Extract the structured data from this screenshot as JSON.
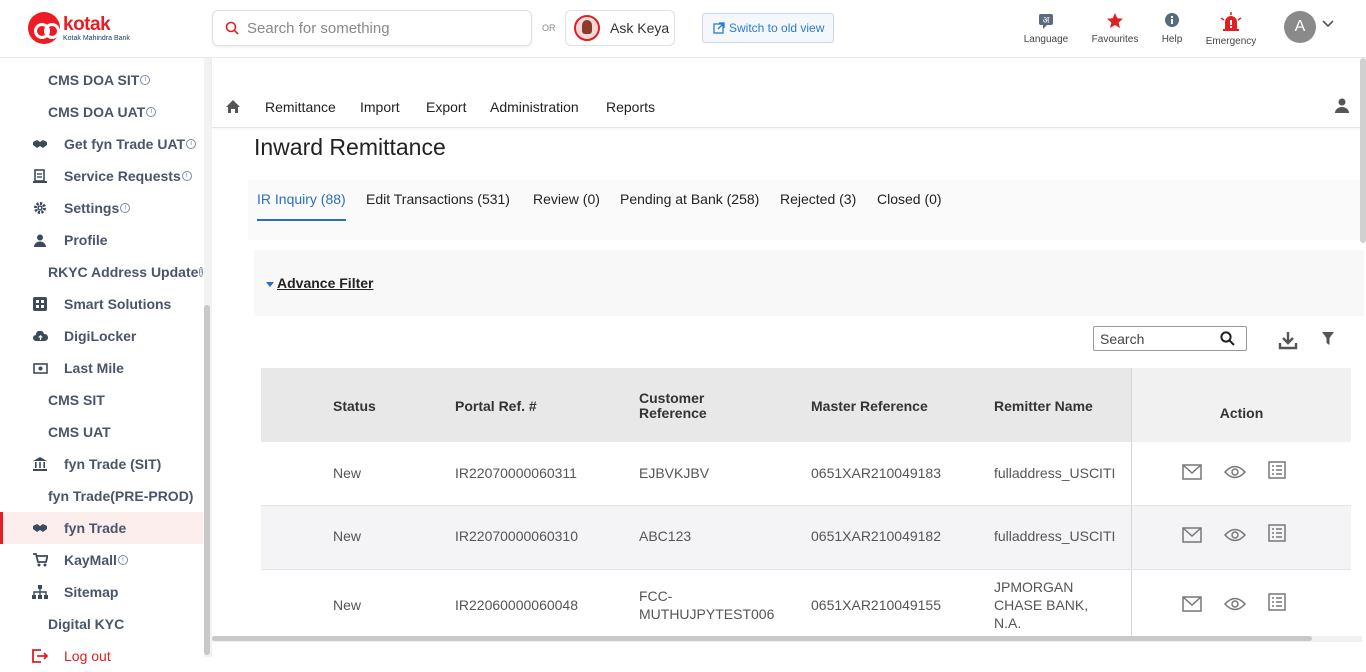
{
  "header": {
    "brand": "kotak",
    "brand_sub": "Kotak Mahindra Bank",
    "search_placeholder": "Search for something",
    "or_label": "OR",
    "ask_keya": "Ask Keya",
    "switch_old_view": "Switch to old view",
    "language": "Language",
    "favourites": "Favourites",
    "help": "Help",
    "emergency": "Emergency",
    "user_initial": "A",
    "language_glyph": "अ"
  },
  "sidebar": {
    "items": [
      {
        "label": "CMS DOA SIT",
        "icon": "none",
        "info": true
      },
      {
        "label": "CMS DOA UAT",
        "icon": "none",
        "info": true
      },
      {
        "label": "Get fyn Trade UAT",
        "icon": "handshake-icon",
        "info": true
      },
      {
        "label": "Service Requests",
        "icon": "service-request-icon",
        "info": true
      },
      {
        "label": "Settings",
        "icon": "gear-icon",
        "info": true
      },
      {
        "label": "Profile",
        "icon": "person-icon",
        "info": false
      },
      {
        "label": "RKYC Address Update",
        "icon": "none",
        "info": true
      },
      {
        "label": "Smart Solutions",
        "icon": "smart-solutions-icon",
        "info": false
      },
      {
        "label": "DigiLocker",
        "icon": "cloud-icon",
        "info": false
      },
      {
        "label": "Last Mile",
        "icon": "cash-icon",
        "info": false
      },
      {
        "label": "CMS SIT",
        "icon": "none",
        "info": false
      },
      {
        "label": "CMS UAT",
        "icon": "none",
        "info": false
      },
      {
        "label": "fyn Trade (SIT)",
        "icon": "bank-icon",
        "info": false
      },
      {
        "label": "fyn Trade(PRE-PROD)",
        "icon": "none",
        "info": false
      },
      {
        "label": "fyn Trade",
        "icon": "handshake-icon",
        "info": false,
        "active": true
      },
      {
        "label": "KayMall",
        "icon": "cart-icon",
        "info": true
      },
      {
        "label": "Sitemap",
        "icon": "sitemap-icon",
        "info": false
      },
      {
        "label": "Digital KYC",
        "icon": "none",
        "info": false
      },
      {
        "label": "Log out",
        "icon": "logout-icon",
        "info": false
      }
    ],
    "info_glyph": "i"
  },
  "nav": {
    "items": [
      "Remittance",
      "Import",
      "Export",
      "Administration",
      "Reports"
    ]
  },
  "page": {
    "title": "Inward Remittance",
    "tabs": [
      "IR Inquiry (88)",
      "Edit Transactions (531)",
      "Review (0)",
      "Pending at Bank (258)",
      "Rejected (3)",
      "Closed (0)"
    ],
    "active_tab": 0,
    "advance_filter": "Advance Filter",
    "table_search_placeholder": "Search"
  },
  "table": {
    "columns": [
      "Status",
      "Portal Ref. #",
      "Customer\nReference",
      "Master Reference",
      "Remitter Name",
      "Action"
    ],
    "rows": [
      {
        "status": "New",
        "portal_ref": "IR22070000060311",
        "customer_ref": "EJBVKJBV",
        "master_ref": "0651XAR210049183",
        "remitter": "fulladdress_USCITI"
      },
      {
        "status": "New",
        "portal_ref": "IR22070000060310",
        "customer_ref": "ABC123",
        "master_ref": "0651XAR210049182",
        "remitter": "fulladdress_USCITI"
      },
      {
        "status": "New",
        "portal_ref": "IR22060000060048",
        "customer_ref": "FCC-\nMUTHUJPYTEST006",
        "master_ref": "0651XAR210049155",
        "remitter": "JPMORGAN\nCHASE BANK,\nN.A."
      }
    ]
  },
  "colors": {
    "brand_red": "#ed1c24",
    "link_blue": "#2a6fbd",
    "sidebar_text": "#4a5568"
  }
}
